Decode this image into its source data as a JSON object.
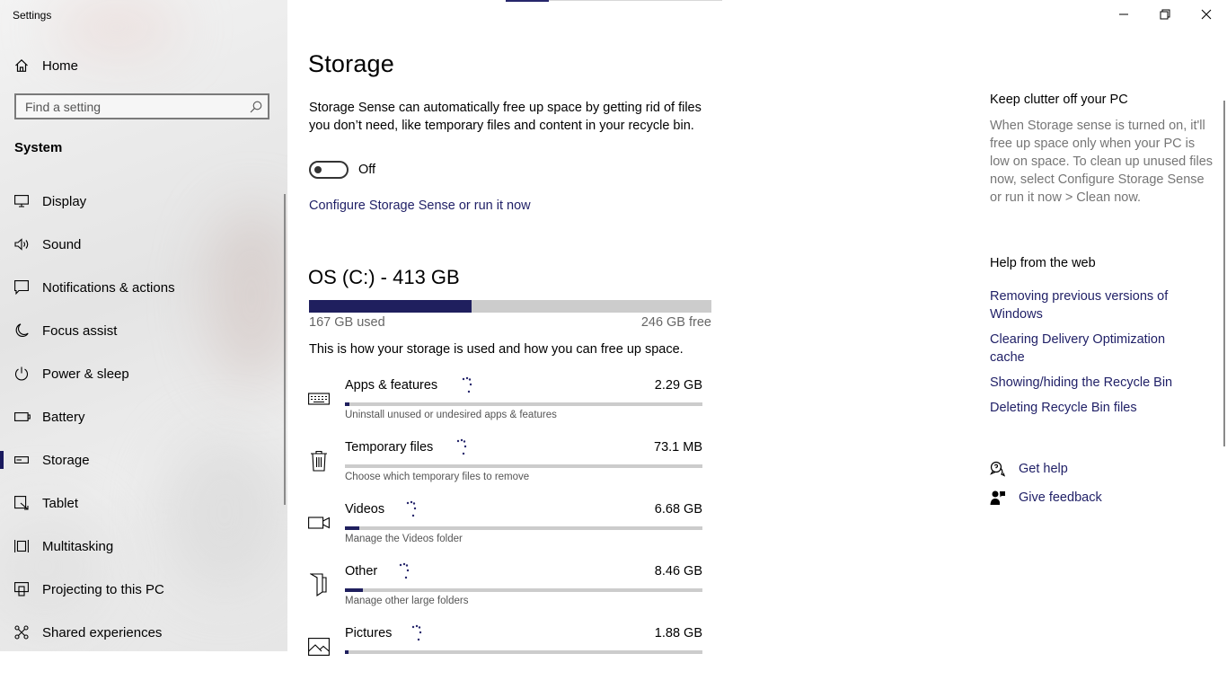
{
  "app": {
    "title": "Settings"
  },
  "sidebar": {
    "home_label": "Home",
    "search_placeholder": "Find a setting",
    "section": "System",
    "items": [
      {
        "label": "Display",
        "icon": "display-icon"
      },
      {
        "label": "Sound",
        "icon": "sound-icon"
      },
      {
        "label": "Notifications & actions",
        "icon": "notifications-icon"
      },
      {
        "label": "Focus assist",
        "icon": "moon-icon"
      },
      {
        "label": "Power & sleep",
        "icon": "power-icon"
      },
      {
        "label": "Battery",
        "icon": "battery-icon"
      },
      {
        "label": "Storage",
        "icon": "storage-icon",
        "active": true
      },
      {
        "label": "Tablet",
        "icon": "tablet-icon"
      },
      {
        "label": "Multitasking",
        "icon": "multitasking-icon"
      },
      {
        "label": "Projecting to this PC",
        "icon": "projecting-icon"
      },
      {
        "label": "Shared experiences",
        "icon": "shared-experiences-icon"
      }
    ]
  },
  "main": {
    "title": "Storage",
    "description": "Storage Sense can automatically free up space by getting rid of files you don’t need, like temporary files and content in your recycle bin.",
    "toggle_state": "Off",
    "configure_link": "Configure Storage Sense or run it now",
    "drive": {
      "title": "OS (C:) - 413 GB",
      "used": "167 GB used",
      "free": "246 GB free",
      "used_fraction": 0.404
    },
    "howto": "This is how your storage is used and how you can free up space.",
    "categories": [
      {
        "name": "Apps & features",
        "size": "2.29 GB",
        "hint": "Uninstall unused or undesired apps & features",
        "icon": "keyboard-icon",
        "fraction": 0.012
      },
      {
        "name": "Temporary files",
        "size": "73.1 MB",
        "hint": "Choose which temporary files to remove",
        "icon": "trash-icon",
        "fraction": 0.0
      },
      {
        "name": "Videos",
        "size": "6.68 GB",
        "hint": "Manage the Videos folder",
        "icon": "video-camera-icon",
        "fraction": 0.04
      },
      {
        "name": "Other",
        "size": "8.46 GB",
        "hint": "Manage other large folders",
        "icon": "folder-icon",
        "fraction": 0.05
      },
      {
        "name": "Pictures",
        "size": "1.88 GB",
        "hint": "",
        "icon": "picture-icon",
        "fraction": 0.011
      }
    ]
  },
  "right": {
    "clutter_title": "Keep clutter off your PC",
    "clutter_text": "When Storage sense is turned on, it'll free up space only when your PC is low on space. To clean up unused files now, select Configure Storage Sense or run it now > Clean now.",
    "web_title": "Help from the web",
    "web_links": [
      "Removing previous versions of Windows",
      "Clearing Delivery Optimization cache",
      "Showing/hiding the Recycle Bin",
      "Deleting Recycle Bin files"
    ],
    "get_help": "Get help",
    "give_feedback": "Give feedback"
  },
  "colors": {
    "accent": "#1f1f5e",
    "link": "#1f1f66",
    "bar_track": "#cccccc",
    "muted_text": "#767676"
  }
}
